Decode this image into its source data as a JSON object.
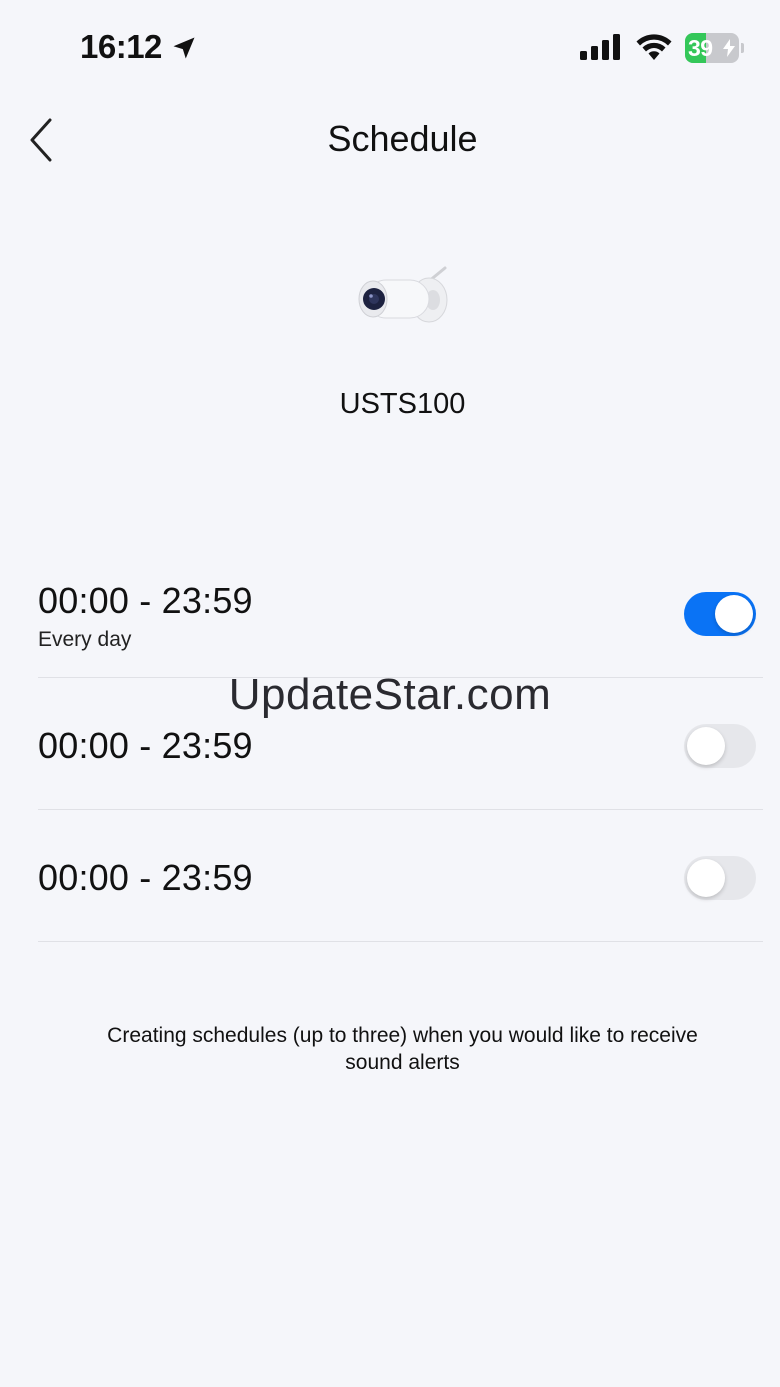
{
  "status_bar": {
    "time": "16:12",
    "battery": "39",
    "battery_level": 0.39,
    "icons": [
      "location-arrow-icon",
      "cellular-signal-icon",
      "wifi-icon",
      "battery-charging-icon"
    ]
  },
  "nav": {
    "back_icon": "chevron-left-icon",
    "title": "Schedule"
  },
  "device": {
    "image_icon": "security-camera-icon",
    "name": "USTS100"
  },
  "schedules": [
    {
      "time": "00:00 - 23:59",
      "days": "Every day",
      "enabled": true
    },
    {
      "time": "00:00 - 23:59",
      "enabled": false
    },
    {
      "time": "00:00 - 23:59",
      "enabled": false
    }
  ],
  "watermark": "UpdateStar.com",
  "footer": {
    "note": "Creating schedules (up to three) when you would like to receive sound alerts"
  },
  "colors": {
    "background": "#f5f6fa",
    "toggle_on": "#0a73f5",
    "toggle_off": "#e6e7eb",
    "battery_green": "#34c759"
  }
}
